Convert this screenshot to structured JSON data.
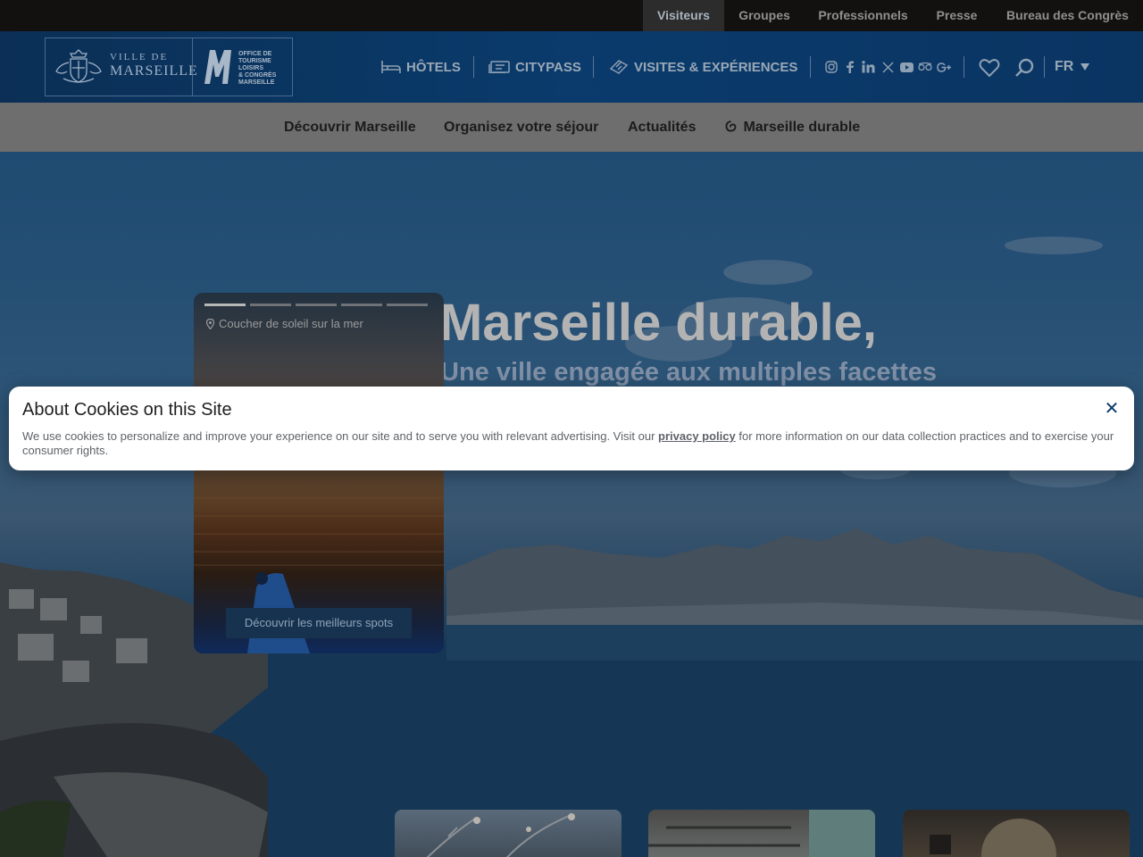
{
  "top_bar": {
    "audiences": [
      "Visiteurs",
      "Groupes",
      "Professionnels",
      "Presse",
      "Bureau des Congrès"
    ],
    "active": "Visiteurs"
  },
  "header": {
    "logo_city": {
      "line1": "VILLE DE",
      "line2": "MARSEILLE"
    },
    "logo_office": {
      "line1": "OFFICE DE",
      "line2": "TOURISME",
      "line3": "LOISIRS",
      "line4": "& CONGRÈS",
      "line5": "MARSEILLE"
    },
    "quick_links": [
      {
        "label": "HÔTELS",
        "icon": "bed-icon"
      },
      {
        "label": "CITYPASS",
        "icon": "ticket-card-icon"
      },
      {
        "label": "VISITES & EXPÉRIENCES",
        "icon": "ticket-icon"
      }
    ],
    "social": [
      "instagram-icon",
      "facebook-icon",
      "linkedin-icon",
      "x-icon",
      "youtube-icon",
      "tripadvisor-icon",
      "google-plus-icon"
    ],
    "language": "FR"
  },
  "main_nav": {
    "items": [
      "Découvrir Marseille",
      "Organisez votre séjour",
      "Actualités",
      "Marseille durable"
    ]
  },
  "hero": {
    "title": "Marseille durable,",
    "subtitle": "Une ville engagée aux multiples facettes"
  },
  "card": {
    "location": "Coucher de soleil sur la mer",
    "button": "Découvrir les meilleurs spots",
    "slide_count": 5,
    "active_slide": 1
  },
  "cookie": {
    "title": "About Cookies on this Site",
    "text_before": "We use cookies to personalize and improve your experience on our site and to serve you with relevant advertising. Visit our ",
    "link": "privacy policy",
    "text_after": " for more information on our data collection practices and to exercise your consumer rights.",
    "close": "✕"
  },
  "colors": {
    "header_blue": "#0a3b6c",
    "top_bar": "#121110",
    "nav_grey": "#6e6e6e",
    "cookie_link": "#5f6368"
  }
}
